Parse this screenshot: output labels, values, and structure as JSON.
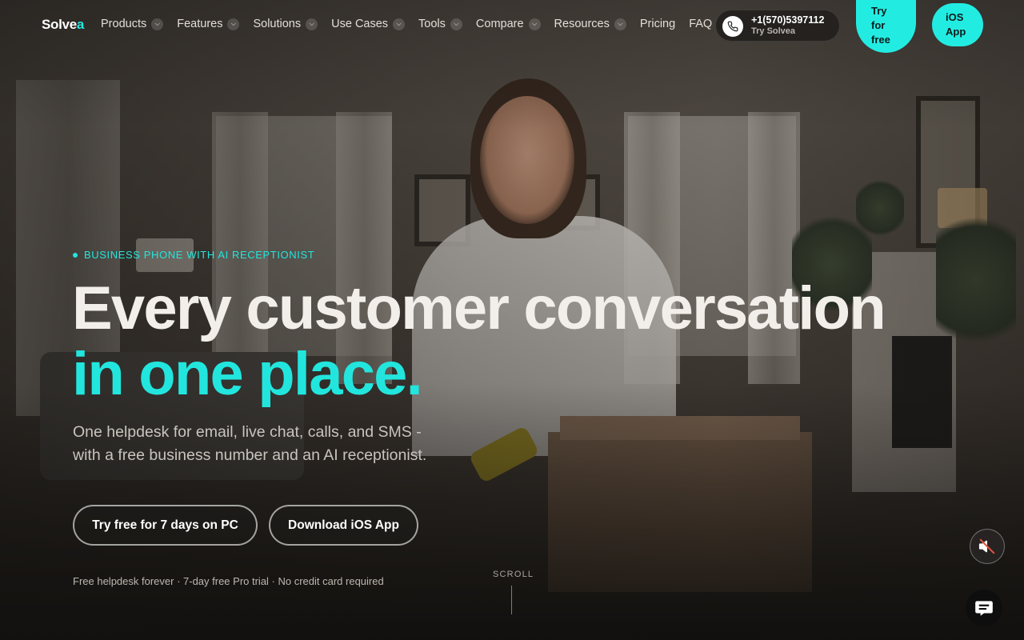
{
  "brand": {
    "name_prefix": "Solve",
    "name_accent": "a",
    "accent_color": "#22e6dd"
  },
  "nav": {
    "items": [
      {
        "label": "Products",
        "has_dropdown": true
      },
      {
        "label": "Features",
        "has_dropdown": true
      },
      {
        "label": "Solutions",
        "has_dropdown": true
      },
      {
        "label": "Use Cases",
        "has_dropdown": true
      },
      {
        "label": "Tools",
        "has_dropdown": true
      },
      {
        "label": "Compare",
        "has_dropdown": true
      },
      {
        "label": "Resources",
        "has_dropdown": true
      },
      {
        "label": "Pricing",
        "has_dropdown": false
      },
      {
        "label": "FAQ",
        "has_dropdown": false
      }
    ],
    "phone": {
      "number": "+1(570)5397112",
      "subtitle": "Try Solvea",
      "icon": "phone-icon"
    },
    "try_free": {
      "line1": "Try",
      "line2": "for",
      "line3": "free"
    },
    "ios_app": {
      "line1": "iOS",
      "line2": "App"
    }
  },
  "hero": {
    "eyebrow": "BUSINESS PHONE WITH AI RECEPTIONIST",
    "headline": "Every customer conversation",
    "headline_accent": "in one place.",
    "subtitle": "One helpdesk for email, live chat, calls, and SMS - with a free business number and an AI receptionist.",
    "primary_button": "Try free for 7 days on PC",
    "secondary_button": "Download iOS App",
    "fineprint": "Free helpdesk forever · 7-day free Pro trial · No credit card required",
    "scroll_label": "SCROLL"
  },
  "widgets": {
    "mute_icon": "speaker-muted-icon",
    "chat_icon": "chat-bubble-icon"
  },
  "colors": {
    "accent": "#22e6dd",
    "cta_bg": "#22ece2"
  }
}
